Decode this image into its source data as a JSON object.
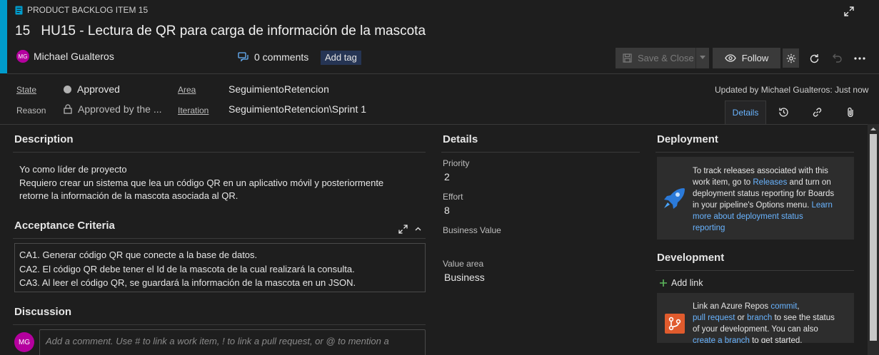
{
  "header": {
    "type_label": "PRODUCT BACKLOG ITEM 15",
    "id": "15",
    "title": "HU15 - Lectura de QR para carga de información de la mascota",
    "assignee_initials": "MG",
    "assignee_name": "Michael Gualteros",
    "comments": "0 comments",
    "add_tag": "Add tag",
    "save_label": "Save & Close",
    "follow_label": "Follow"
  },
  "fields": {
    "state_label": "State",
    "state_value": "Approved",
    "reason_label": "Reason",
    "reason_value": "Approved by the ...",
    "area_label": "Area",
    "area_value": "SeguimientoRetencion",
    "iteration_label": "Iteration",
    "iteration_value": "SeguimientoRetencion\\Sprint 1",
    "updated": "Updated by Michael Gualteros: Just now"
  },
  "tabs": {
    "details": "Details"
  },
  "description": {
    "title": "Description",
    "line1": "Yo como líder de proyecto",
    "line2": "Requiero crear un sistema que lea un código QR en un aplicativo móvil y posteriormente",
    "line3": "retorne la información de la mascota asociada al QR."
  },
  "acceptance": {
    "title": "Acceptance Criteria",
    "line1": "CA1. Generar código QR que conecte a la base de datos.",
    "line2": "CA2. El código QR debe tener el Id de la mascota de la cual realizará la consulta.",
    "line3": "CA3. Al leer el código QR, se guardará la información de la mascota en un JSON."
  },
  "discussion": {
    "title": "Discussion",
    "avatar": "MG",
    "placeholder": "Add a comment. Use # to link a work item, ! to link a pull request, or @ to mention a"
  },
  "details": {
    "title": "Details",
    "priority_label": "Priority",
    "priority_value": "2",
    "effort_label": "Effort",
    "effort_value": "8",
    "business_value_label": "Business Value",
    "value_area_label": "Value area",
    "value_area_value": "Business"
  },
  "deployment": {
    "title": "Deployment",
    "l1": "To track releases associated with this",
    "l2a": "work item, go to ",
    "l2link": "Releases",
    "l2b": " and turn on",
    "l3": "deployment status reporting for Boards",
    "l4a": "in your pipeline's Options menu. ",
    "l4link": "Learn",
    "l5link": "more about deployment status",
    "l6link": "reporting"
  },
  "development": {
    "title": "Development",
    "add_link": "Add link",
    "l1a": "Link an Azure Repos ",
    "l1link": "commit",
    "l1b": ",",
    "l2link": "pull request",
    "l2a": " or ",
    "l2link2": "branch",
    "l2b": " to see the status",
    "l3": "of your development. You can also",
    "l4link": "create a branch",
    "l4b": " to get started."
  },
  "colors": {
    "accent": "#009ccc",
    "link": "#69b4ff",
    "avatar": "#b4009e",
    "tag_bg": "#263554"
  }
}
